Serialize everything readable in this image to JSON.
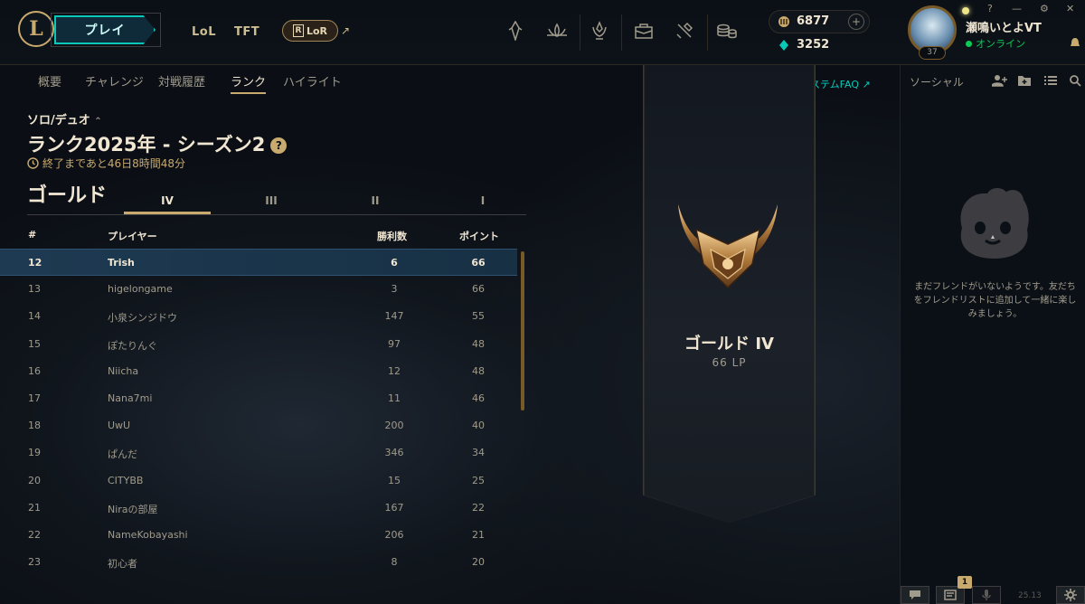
{
  "topbar": {
    "logo_letter": "L",
    "play_label": "プレイ",
    "games": [
      {
        "label": "LoL"
      },
      {
        "label": "TFT"
      }
    ],
    "lor": {
      "glyph": "R",
      "label": "LoR",
      "ext": "↗"
    },
    "nav_icons": [
      "crystal-icon",
      "lotus-icon",
      "champions-icon",
      "store-icon",
      "crafting-icon",
      "coins-icon"
    ],
    "currency": {
      "rp": "6877",
      "add": "+",
      "be": "3252"
    },
    "user": {
      "name": "瀬鳴いとよVT",
      "status": "オンライン",
      "level": "37"
    },
    "window_controls": [
      "?",
      "—",
      "⚙",
      "✕"
    ]
  },
  "subnav": {
    "tabs": [
      {
        "label": "概要",
        "active": false
      },
      {
        "label": "チャレンジ",
        "active": false
      },
      {
        "label": "対戦履歴",
        "active": false
      },
      {
        "label": "ランク",
        "active": true
      },
      {
        "label": "ハイライト",
        "active": false
      }
    ],
    "faq": "リーグシステムFAQ ↗"
  },
  "ranked": {
    "queue": "ソロ/デュオ",
    "queue_arrow": "⌃",
    "season": "ランク2025年 - シーズン2",
    "help": "?",
    "time_left": "終了まであと46日8時間48分",
    "tier": "ゴールド",
    "divisions": [
      {
        "label": "IV",
        "active": true
      },
      {
        "label": "III",
        "active": false
      },
      {
        "label": "II",
        "active": false
      },
      {
        "label": "I",
        "active": false
      }
    ],
    "columns": {
      "rank": "#",
      "player": "プレイヤー",
      "wins": "勝利数",
      "points": "ポイント"
    },
    "rows": [
      {
        "rank": "12",
        "player": "Trish",
        "wins": "6",
        "points": "66",
        "me": true
      },
      {
        "rank": "13",
        "player": "higelongame",
        "wins": "3",
        "points": "66",
        "me": false
      },
      {
        "rank": "14",
        "player": "小泉シンジドウ",
        "wins": "147",
        "points": "55",
        "me": false
      },
      {
        "rank": "15",
        "player": "ぽたりんぐ",
        "wins": "97",
        "points": "48",
        "me": false
      },
      {
        "rank": "16",
        "player": "Niicha",
        "wins": "12",
        "points": "48",
        "me": false
      },
      {
        "rank": "17",
        "player": "Nana7mi",
        "wins": "11",
        "points": "46",
        "me": false
      },
      {
        "rank": "18",
        "player": "UwU",
        "wins": "200",
        "points": "40",
        "me": false
      },
      {
        "rank": "19",
        "player": "ぱんだ",
        "wins": "346",
        "points": "34",
        "me": false
      },
      {
        "rank": "20",
        "player": "CITYBB",
        "wins": "15",
        "points": "25",
        "me": false
      },
      {
        "rank": "21",
        "player": "Niraの部屋",
        "wins": "167",
        "points": "22",
        "me": false
      },
      {
        "rank": "22",
        "player": "NameKobayashi",
        "wins": "206",
        "points": "21",
        "me": false
      },
      {
        "rank": "23",
        "player": "初心者",
        "wins": "8",
        "points": "20",
        "me": false
      }
    ],
    "banner": {
      "rank": "ゴールド IV",
      "lp": "66 LP"
    }
  },
  "social": {
    "title": "ソーシャル",
    "icons": [
      "add-friend-icon",
      "add-folder-icon",
      "list-icon",
      "search-icon"
    ],
    "empty_message": "まだフレンドがいないようです。友だちをフレンドリストに追加して一緒に楽しみましょう。",
    "footer": {
      "badge": "1",
      "version": "25.13"
    }
  },
  "colors": {
    "gold": "#c8aa6e",
    "teal": "#0ac8b9",
    "highlight_row": "#1e3a52",
    "online": "#0acb56"
  }
}
